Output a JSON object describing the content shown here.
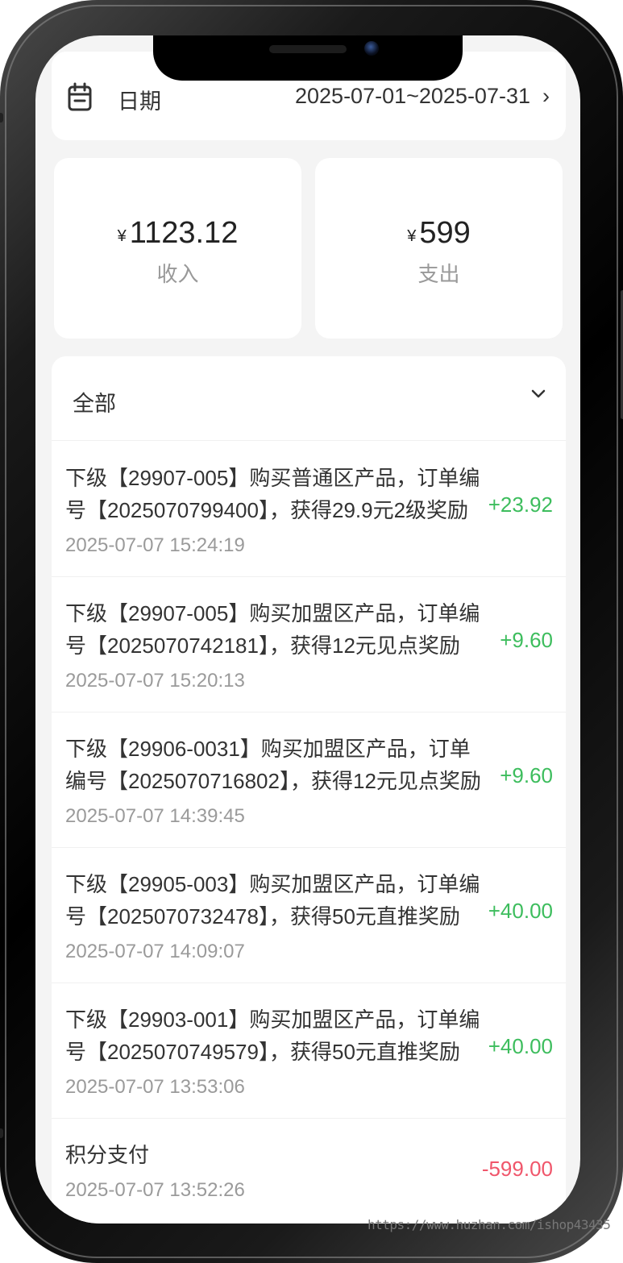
{
  "date_filter": {
    "label": "日期",
    "range": "2025-07-01~2025-07-31",
    "chevron": "›"
  },
  "summary": {
    "currency": "¥",
    "income": {
      "value": "1123.12",
      "label": "收入"
    },
    "expense": {
      "value": "599",
      "label": "支出"
    }
  },
  "type_filter": {
    "label": "全部"
  },
  "transactions": [
    {
      "desc": "下级【29907-005】购买普通区产品，订单编号【2025070799400】，获得29.9元2级奖励",
      "time": "2025-07-07 15:24:19",
      "amount": "+23.92"
    },
    {
      "desc": "下级【29907-005】购买加盟区产品，订单编号【2025070742181】，获得12元见点奖励",
      "time": "2025-07-07 15:20:13",
      "amount": "+9.60"
    },
    {
      "desc": "下级【29906-0031】购买加盟区产品，订单编号【2025070716802】，获得12元见点奖励",
      "time": "2025-07-07 14:39:45",
      "amount": "+9.60"
    },
    {
      "desc": "下级【29905-003】购买加盟区产品，订单编号【2025070732478】，获得50元直推奖励",
      "time": "2025-07-07 14:09:07",
      "amount": "+40.00"
    },
    {
      "desc": "下级【29903-001】购买加盟区产品，订单编号【2025070749579】，获得50元直推奖励",
      "time": "2025-07-07 13:53:06",
      "amount": "+40.00"
    },
    {
      "desc": "积分支付",
      "time": "2025-07-07 13:52:26",
      "amount": "-599.00"
    }
  ],
  "colors": {
    "positive": "#3dbd5d",
    "negative": "#f0566b"
  },
  "icons": {
    "date": "calendar-icon",
    "filter": "chevron-down-icon",
    "range": "chevron-right-icon"
  },
  "watermark": "https://www.huzhan.com/ishop43435"
}
